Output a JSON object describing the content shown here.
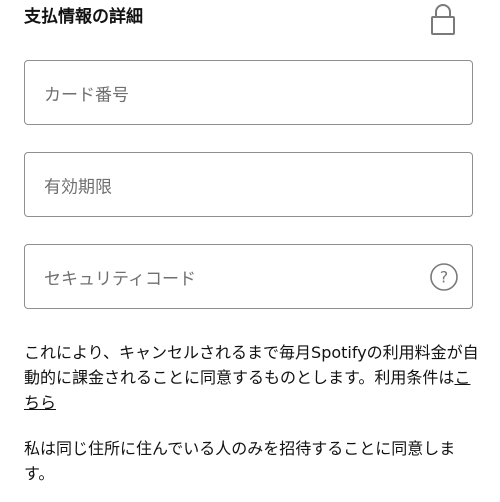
{
  "header": {
    "title": "支払情報の詳細",
    "icon": "lock-icon"
  },
  "fields": {
    "card_number": {
      "placeholder": "カード番号",
      "value": ""
    },
    "expiry": {
      "placeholder": "有効期限",
      "value": ""
    },
    "security_code": {
      "placeholder": "セキュリティコード",
      "value": "",
      "help_icon": "question-circle-icon"
    }
  },
  "terms": {
    "text": "これにより、キャンセルされるまで毎月Spotifyの利用料金が自動的に課金されることに同意するものとします。利用条件は",
    "link_label": "こちら"
  },
  "consent": {
    "text": "私は同じ住所に住んでいる人のみを招待することに同意します。"
  }
}
